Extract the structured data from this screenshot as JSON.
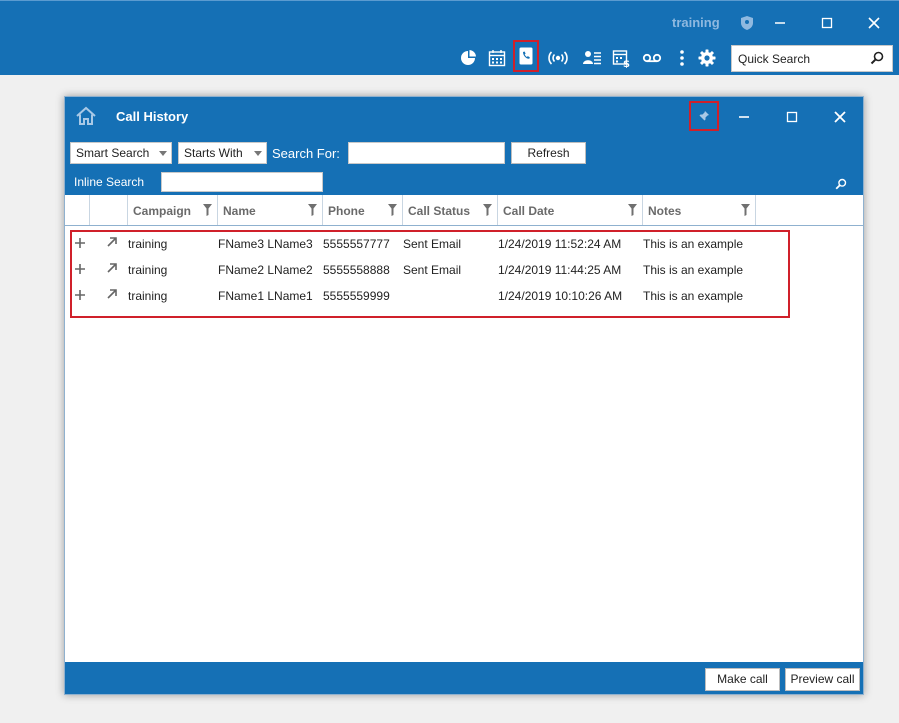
{
  "app_bar": {
    "user": "training",
    "quick_search_placeholder": "Quick Search",
    "toolbar_icons": [
      "dashboard-icon",
      "calendar-icon",
      "call-history-icon",
      "broadcast-icon",
      "contacts-list-icon",
      "billing-calendar-icon",
      "voicemail-icon",
      "more-icon",
      "settings-icon"
    ],
    "accent": "#1570b5",
    "highlight": "#d0202a"
  },
  "window": {
    "title": "Call History",
    "smart_search": "Smart Search",
    "starts_with": "Starts With",
    "search_for_label": "Search For:",
    "refresh_label": "Refresh",
    "inline_search_label": "Inline Search",
    "columns": [
      "Campaign",
      "Name",
      "Phone",
      "Call Status",
      "Call Date",
      "Notes"
    ],
    "rows": [
      {
        "campaign": "training",
        "name": "FName3 LName3",
        "phone": "5555557777",
        "status": "Sent Email",
        "date": "1/24/2019 11:52:24 AM",
        "notes": "This is an example"
      },
      {
        "campaign": "training",
        "name": "FName2 LName2",
        "phone": "5555558888",
        "status": "Sent Email",
        "date": "1/24/2019 11:44:25 AM",
        "notes": "This is an example"
      },
      {
        "campaign": "training",
        "name": "FName1 LName1",
        "phone": "5555559999",
        "status": "",
        "date": "1/24/2019 10:10:26 AM",
        "notes": "This is an example"
      }
    ],
    "make_call_label": "Make call",
    "preview_call_label": "Preview call"
  }
}
